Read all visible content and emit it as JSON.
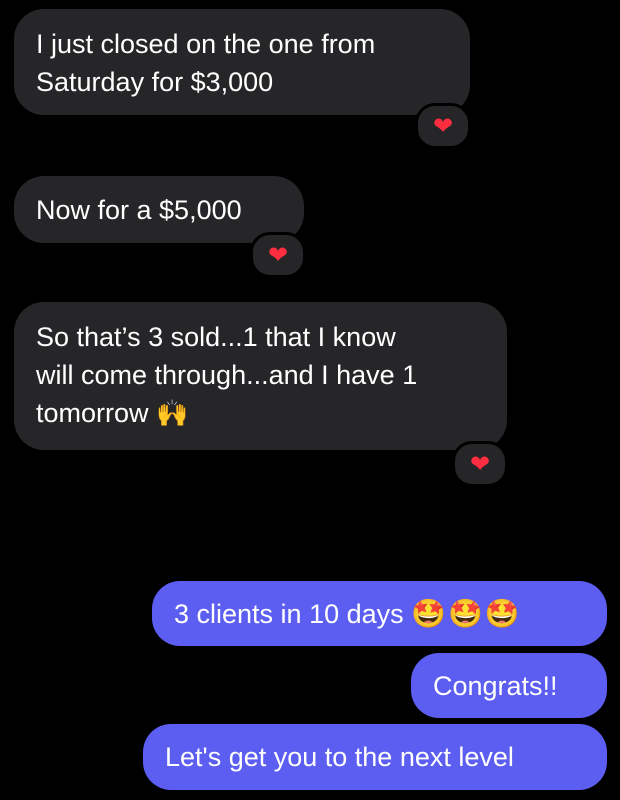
{
  "received": [
    {
      "text": "I just closed on the one from\nSaturday for $3,000",
      "emoji": "",
      "reaction": "❤"
    },
    {
      "text": "Now for a $5,000",
      "emoji": "",
      "reaction": "❤"
    },
    {
      "text": "So that’s 3 sold...1 that I know\nwill come through...and I have 1\ntomorrow",
      "emoji": "🙌",
      "reaction": "❤"
    }
  ],
  "sent": [
    {
      "text": "3 clients in 10 days",
      "emoji": "🤩🤩🤩"
    },
    {
      "text": "Congrats!!",
      "emoji": ""
    },
    {
      "text": "Let's get you to the next level",
      "emoji": ""
    }
  ],
  "colors": {
    "background": "#000000",
    "received_bubble": "#262628",
    "sent_bubble": "#5b5ef0",
    "reaction_heart": "#ff2d40"
  },
  "icons": {
    "reaction": "red-heart-icon",
    "raising_hands": "raising-hands-icon",
    "star_struck": "star-struck-face-icon"
  }
}
